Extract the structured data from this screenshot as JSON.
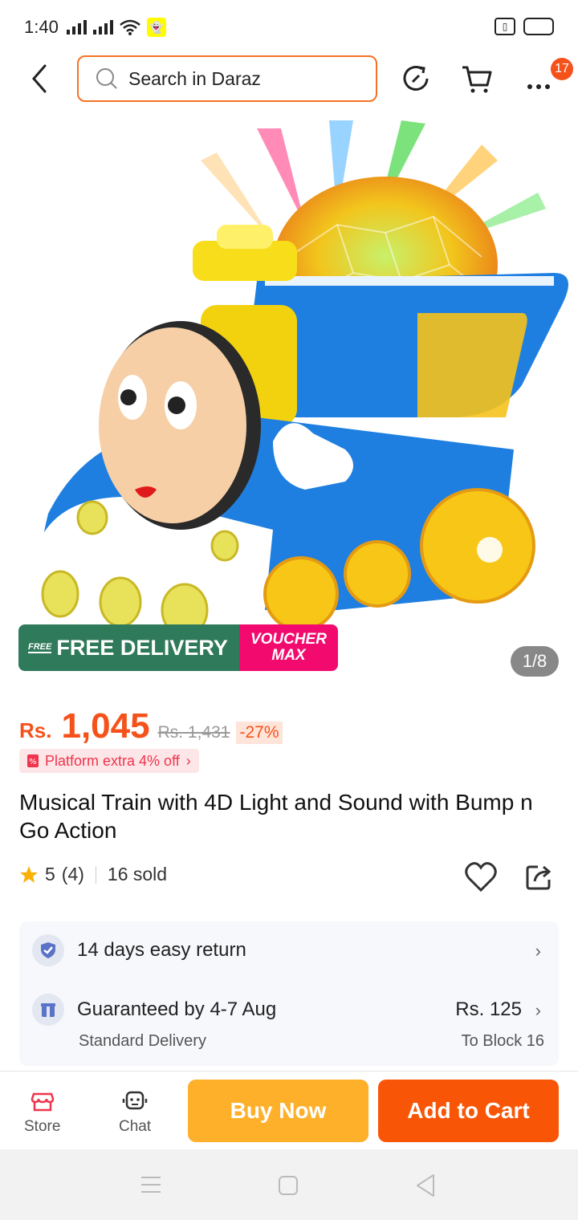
{
  "status": {
    "time": "1:40"
  },
  "header": {
    "search_placeholder": "Search in Daraz",
    "cart_badge": "17"
  },
  "gallery": {
    "promo_free_delivery": "FREE DELIVERY",
    "promo_free_tag": "FREE",
    "promo_voucher_line1": "VOUCHER",
    "promo_voucher_line2": "MAX",
    "image_counter": "1/8"
  },
  "product": {
    "currency": "Rs.",
    "price": "1,045",
    "old_price": "Rs. 1,431",
    "discount": "-27%",
    "platform_offer": "Platform extra 4% off",
    "title": "Musical Train with 4D Light and Sound with Bump n Go Action",
    "rating": "5",
    "reviews": "(4)",
    "sold": "16 sold"
  },
  "service": {
    "return_label": "14 days easy return",
    "delivery_label": "Guaranteed by 4-7 Aug",
    "delivery_type": "Standard Delivery",
    "delivery_fee": "Rs. 125",
    "delivery_location": "To Block 16"
  },
  "actions": {
    "store": "Store",
    "chat": "Chat",
    "buy_now": "Buy Now",
    "add_to_cart": "Add to Cart"
  },
  "colors": {
    "accent": "#F57224",
    "buy_now": "#FEB02A",
    "add_to_cart": "#F85606"
  }
}
